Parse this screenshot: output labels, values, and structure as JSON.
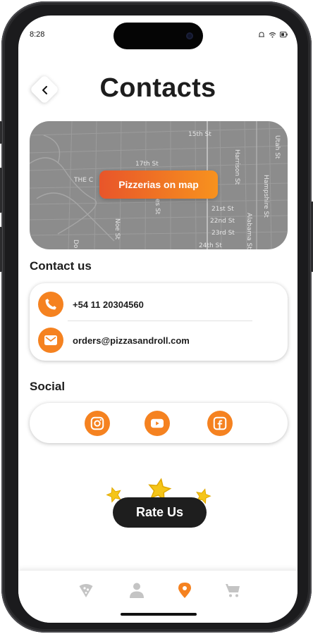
{
  "status_bar": {
    "time": "8:28"
  },
  "header": {
    "title": "Contacts"
  },
  "map": {
    "button_label": "Pizzerias on map",
    "streets": [
      "15th St",
      "17th St",
      "THE C",
      "es St",
      "Noe St",
      "Harrison St",
      "Hampshire St",
      "Utah St",
      "21st St",
      "22nd St",
      "23rd St",
      "24th St",
      "Alabama St",
      "Do"
    ]
  },
  "contact": {
    "section_title": "Contact us",
    "phone": "+54 11 20304560",
    "email": "orders@pizzasandroll.com"
  },
  "social": {
    "section_title": "Social",
    "items": [
      "instagram",
      "youtube",
      "facebook"
    ]
  },
  "rate": {
    "label": "Rate Us"
  },
  "tabbar": {
    "items": [
      "pizza",
      "profile",
      "location",
      "cart"
    ],
    "active": "location"
  },
  "colors": {
    "accent": "#f58220",
    "dark": "#1e1e1e",
    "inactive": "#c4c4c4",
    "star": "#f5c518"
  }
}
